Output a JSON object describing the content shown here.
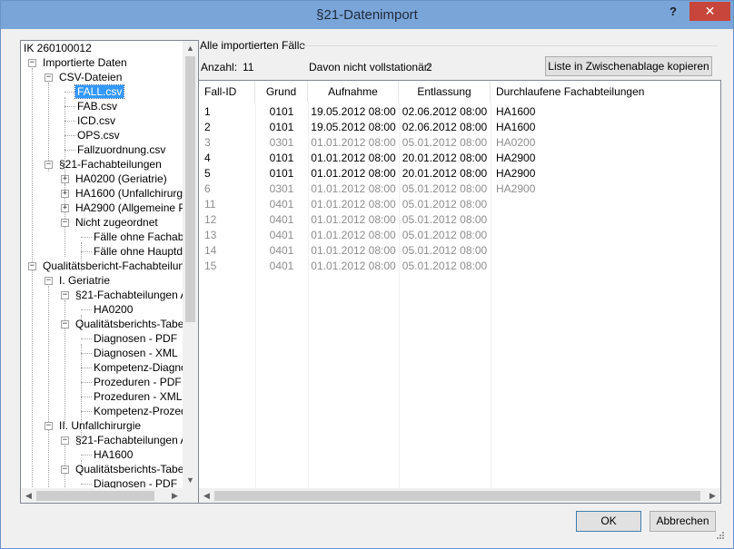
{
  "window": {
    "title": "§21-Datenimport",
    "help": "?",
    "close": "✕"
  },
  "tree": {
    "nodes": [
      {
        "label": "IK 260100012"
      },
      {
        "label": "Importierte Daten"
      },
      {
        "label": "CSV-Dateien"
      },
      {
        "label": "FALL.csv"
      },
      {
        "label": "FAB.csv"
      },
      {
        "label": "ICD.csv"
      },
      {
        "label": "OPS.csv"
      },
      {
        "label": "Fallzuordnung.csv"
      },
      {
        "label": "§21-Fachabteilungen"
      },
      {
        "label": "HA0200 (Geriatrie)"
      },
      {
        "label": "HA1600 (Unfallchirurgie"
      },
      {
        "label": "HA2900 (Allgemeine Ps"
      },
      {
        "label": "Nicht zugeordnet"
      },
      {
        "label": "Fälle ohne Fachabt"
      },
      {
        "label": "Fälle ohne Hauptdia"
      },
      {
        "label": "Qualitätsbericht-Fachabteilunge"
      },
      {
        "label": "I. Geriatrie"
      },
      {
        "label": "§21-Fachabteilungen A"
      },
      {
        "label": "HA0200"
      },
      {
        "label": "Qualitätsberichts-Tabell"
      },
      {
        "label": "Diagnosen - PDF"
      },
      {
        "label": "Diagnosen - XML"
      },
      {
        "label": "Kompetenz-Diagno"
      },
      {
        "label": "Prozeduren - PDF"
      },
      {
        "label": "Prozeduren - XML"
      },
      {
        "label": "Kompetenz-Prozedu"
      },
      {
        "label": "II. Unfallchirurgie"
      },
      {
        "label": "§21-Fachabteilungen A"
      },
      {
        "label": "HA1600"
      },
      {
        "label": "Qualitätsberichts-Tabell"
      },
      {
        "label": "Diagnosen - PDF"
      }
    ]
  },
  "group": {
    "title": "Alle importierten Fälle",
    "count_label": "Anzahl:",
    "count_value": "11",
    "not_full_label": "Davon nicht vollstationär:",
    "not_full_value": "2",
    "copy_button": "Liste in Zwischenablage kopieren"
  },
  "table": {
    "columns": [
      "Fall-ID",
      "Grund",
      "Aufnahme",
      "Entlassung",
      "Durchlaufene Fachabteilungen"
    ],
    "rows": [
      {
        "id": "1",
        "grund": "0101",
        "aufnahme": "19.05.2012 08:00",
        "entlassung": "02.06.2012 08:00",
        "fab": "HA1600",
        "grey": false
      },
      {
        "id": "2",
        "grund": "0101",
        "aufnahme": "19.05.2012 08:00",
        "entlassung": "02.06.2012 08:00",
        "fab": "HA1600",
        "grey": false
      },
      {
        "id": "3",
        "grund": "0301",
        "aufnahme": "01.01.2012 08:00",
        "entlassung": "05.01.2012 08:00",
        "fab": "HA0200",
        "grey": true
      },
      {
        "id": "4",
        "grund": "0101",
        "aufnahme": "01.01.2012 08:00",
        "entlassung": "20.01.2012 08:00",
        "fab": "HA2900",
        "grey": false
      },
      {
        "id": "5",
        "grund": "0101",
        "aufnahme": "01.01.2012 08:00",
        "entlassung": "20.01.2012 08:00",
        "fab": "HA2900",
        "grey": false
      },
      {
        "id": "6",
        "grund": "0301",
        "aufnahme": "01.01.2012 08:00",
        "entlassung": "05.01.2012 08:00",
        "fab": "HA2900",
        "grey": true
      },
      {
        "id": "11",
        "grund": "0401",
        "aufnahme": "01.01.2012 08:00",
        "entlassung": "05.01.2012 08:00",
        "fab": "",
        "grey": true
      },
      {
        "id": "12",
        "grund": "0401",
        "aufnahme": "01.01.2012 08:00",
        "entlassung": "05.01.2012 08:00",
        "fab": "",
        "grey": true
      },
      {
        "id": "13",
        "grund": "0401",
        "aufnahme": "01.01.2012 08:00",
        "entlassung": "05.01.2012 08:00",
        "fab": "",
        "grey": true
      },
      {
        "id": "14",
        "grund": "0401",
        "aufnahme": "01.01.2012 08:00",
        "entlassung": "05.01.2012 08:00",
        "fab": "",
        "grey": true
      },
      {
        "id": "15",
        "grund": "0401",
        "aufnahme": "01.01.2012 08:00",
        "entlassung": "05.01.2012 08:00",
        "fab": "",
        "grey": true
      }
    ]
  },
  "buttons": {
    "ok": "OK",
    "cancel": "Abbrechen"
  },
  "colors": {
    "titlebar": "#7aa5d9",
    "close": "#c7453a",
    "selection": "#3399ff",
    "grey_text": "#8d8d8d"
  }
}
